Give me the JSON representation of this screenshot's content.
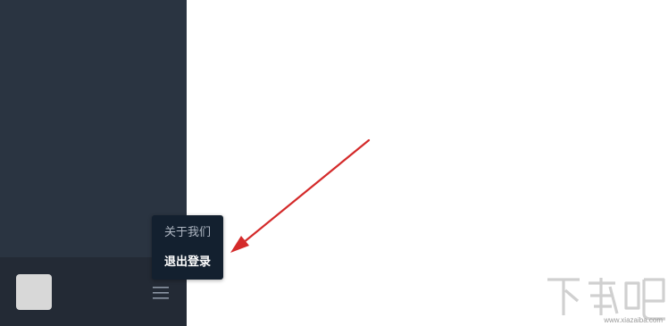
{
  "popup_menu": {
    "items": [
      {
        "label": "关于我们",
        "id": "about"
      },
      {
        "label": "退出登录",
        "id": "logout"
      }
    ]
  },
  "sidebar": {
    "avatar": "avatar-placeholder",
    "menu_icon": "hamburger-icon"
  },
  "annotation": {
    "color": "#d42a2a",
    "icon": "red-arrow"
  },
  "watermark": {
    "logo_text": "下载吧",
    "url": "www.xiazaiba.com"
  },
  "colors": {
    "sidebar_bg": "#2a3441",
    "sidebar_footer_bg": "#232a35",
    "menu_bg": "#13202f"
  }
}
